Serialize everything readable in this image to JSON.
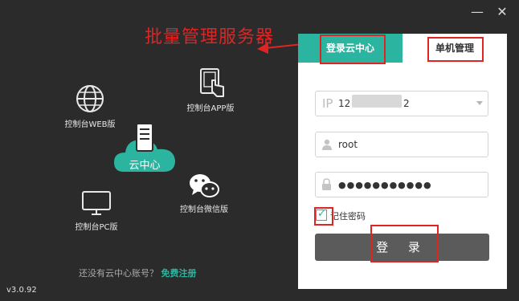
{
  "window": {
    "minimize_label": "—",
    "close_label": "✕"
  },
  "annotation": {
    "title": "批量管理服务器"
  },
  "left": {
    "items": [
      {
        "label": "控制台WEB版",
        "icon": "globe-icon"
      },
      {
        "label": "控制台APP版",
        "icon": "tablet-touch-icon"
      },
      {
        "label": "控制台微信版",
        "icon": "wechat-icon"
      },
      {
        "label": "控制台PC版",
        "icon": "monitor-icon"
      }
    ],
    "cloud_label": "云中心",
    "register_prompt": "还没有云中心账号？",
    "register_link": "免费注册",
    "version": "v3.0.92"
  },
  "login": {
    "tabs": [
      "登录云中心",
      "单机管理"
    ],
    "ip_prefix": "IP",
    "ip_value": "12",
    "ip_suffix": "2",
    "username_value": "root",
    "password_value": "●●●●●●●●●●●",
    "remember_label": "记住密码",
    "login_button": "登 录"
  },
  "colors": {
    "accent": "#2bb5a0",
    "annotation": "#e02424",
    "background": "#2b2b2b",
    "button": "#5b5b5b"
  }
}
